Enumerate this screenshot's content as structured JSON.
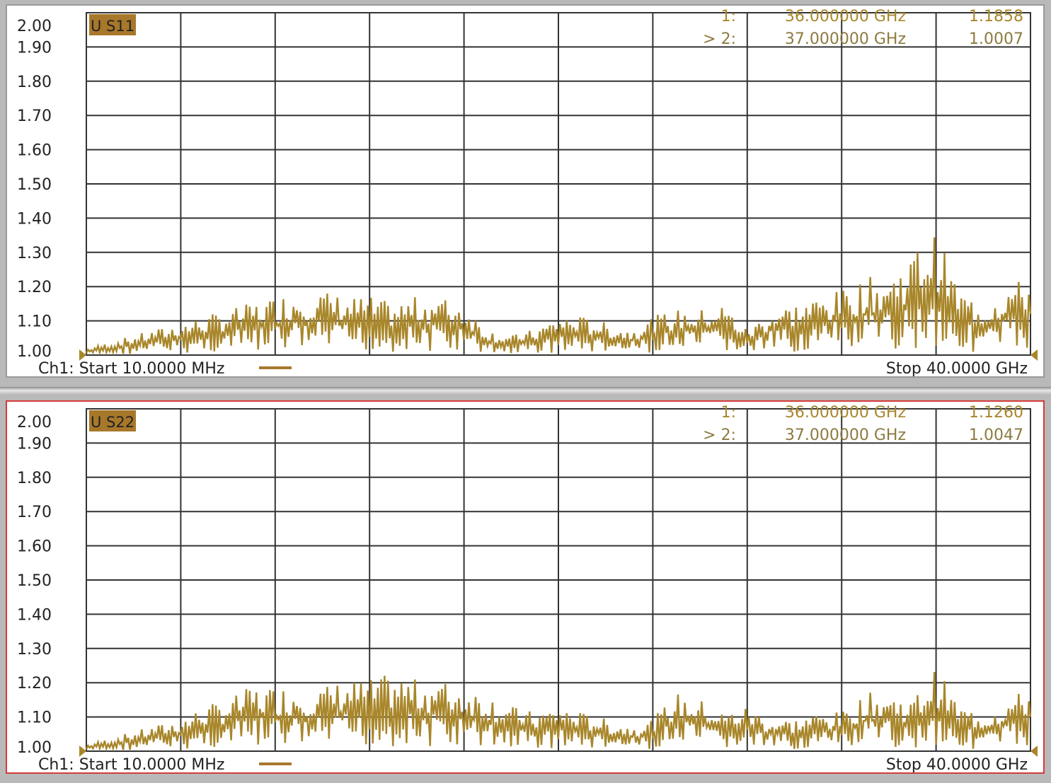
{
  "chart_data": [
    {
      "type": "line",
      "trace_label": "U S11",
      "yticks": [
        "2.00",
        "1.90",
        "1.80",
        "1.70",
        "1.60",
        "1.50",
        "1.40",
        "1.30",
        "1.20",
        "1.10",
        "1.00"
      ],
      "ylim": [
        1.0,
        2.0
      ],
      "xlim_ghz": [
        0.01,
        40.0
      ],
      "grid": true,
      "color": "#a8862a",
      "markers": [
        {
          "id": "1:",
          "freq": "36.000000 GHz",
          "value": "1.1858"
        },
        {
          "id": "> 2:",
          "freq": "37.000000 GHz",
          "value": "1.0007"
        }
      ],
      "footer": {
        "start": "Ch1: Start  10.0000 MHz",
        "stop": "Stop  40.0000 GHz"
      },
      "series": [
        {
          "x_ghz": [
            0.01,
            1.0,
            2.0,
            3.0,
            4.0,
            5.0,
            6.0,
            7.0,
            8.0,
            9.0,
            10.0,
            11.0,
            12.0,
            13.0,
            14.0,
            15.0,
            16.0,
            17.0,
            18.0,
            19.0,
            20.0,
            21.0,
            22.0,
            23.0,
            24.0,
            25.0,
            26.0,
            27.0,
            28.0,
            29.0,
            30.0,
            31.0,
            32.0,
            33.0,
            34.0,
            35.0,
            36.0,
            37.0,
            38.0,
            39.0,
            40.0
          ],
          "values": [
            1.01,
            1.02,
            1.03,
            1.04,
            1.05,
            1.06,
            1.07,
            1.08,
            1.09,
            1.1,
            1.1,
            1.09,
            1.09,
            1.08,
            1.09,
            1.09,
            1.08,
            1.04,
            1.03,
            1.04,
            1.06,
            1.06,
            1.05,
            1.04,
            1.06,
            1.07,
            1.07,
            1.08,
            1.04,
            1.07,
            1.08,
            1.09,
            1.1,
            1.12,
            1.12,
            1.16,
            1.19,
            1.1,
            1.08,
            1.11,
            1.12
          ]
        }
      ]
    },
    {
      "type": "line",
      "trace_label": "U S22",
      "yticks": [
        "2.00",
        "1.90",
        "1.80",
        "1.70",
        "1.60",
        "1.50",
        "1.40",
        "1.30",
        "1.20",
        "1.10",
        "1.00"
      ],
      "ylim": [
        1.0,
        2.0
      ],
      "xlim_ghz": [
        0.01,
        40.0
      ],
      "grid": true,
      "color": "#a8862a",
      "markers": [
        {
          "id": "1:",
          "freq": "36.000000 GHz",
          "value": "1.1260"
        },
        {
          "id": "> 2:",
          "freq": "37.000000 GHz",
          "value": "1.0047"
        }
      ],
      "footer": {
        "start": "Ch1: Start  10.0000 MHz",
        "stop": "Stop  40.0000 GHz"
      },
      "series": [
        {
          "x_ghz": [
            0.01,
            1.0,
            2.0,
            3.0,
            4.0,
            5.0,
            6.0,
            7.0,
            8.0,
            9.0,
            10.0,
            11.0,
            12.0,
            13.0,
            14.0,
            15.0,
            16.0,
            17.0,
            18.0,
            19.0,
            20.0,
            21.0,
            22.0,
            23.0,
            24.0,
            25.0,
            26.0,
            27.0,
            28.0,
            29.0,
            30.0,
            31.0,
            32.0,
            33.0,
            34.0,
            35.0,
            36.0,
            37.0,
            38.0,
            39.0,
            40.0
          ],
          "values": [
            1.01,
            1.02,
            1.03,
            1.04,
            1.05,
            1.07,
            1.08,
            1.1,
            1.1,
            1.1,
            1.1,
            1.11,
            1.11,
            1.12,
            1.11,
            1.11,
            1.1,
            1.09,
            1.07,
            1.06,
            1.07,
            1.06,
            1.05,
            1.04,
            1.05,
            1.09,
            1.08,
            1.06,
            1.07,
            1.05,
            1.05,
            1.06,
            1.06,
            1.09,
            1.09,
            1.08,
            1.13,
            1.07,
            1.06,
            1.08,
            1.1
          ]
        }
      ]
    }
  ]
}
